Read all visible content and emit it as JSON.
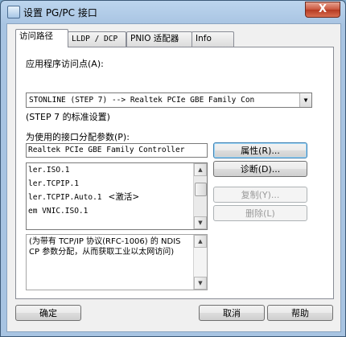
{
  "window": {
    "title": "设置 PG/PC 接口",
    "close_label": "X"
  },
  "tabs": [
    {
      "label": "访问路径"
    },
    {
      "label": "LLDP / DCP"
    },
    {
      "label": "PNIO 适配器"
    },
    {
      "label": "Info"
    }
  ],
  "access_point": {
    "label": "应用程序访问点(A):",
    "value": "STONLINE (STEP 7)        --> Realtek PCIe GBE Family Con",
    "hint": "(STEP 7 的标准设置)"
  },
  "interface": {
    "label": "为使用的接口分配参数(P):",
    "value": "Realtek PCIe GBE Family Controller",
    "items": [
      {
        "text": "ler.ISO.1",
        "tag": ""
      },
      {
        "text": "ler.TCPIP.1",
        "tag": ""
      },
      {
        "text": "ler.TCPIP.Auto.1",
        "tag": "<激活>"
      },
      {
        "text": "em VNIC.ISO.1",
        "tag": ""
      }
    ]
  },
  "buttons": {
    "properties": "属性(R)...",
    "diagnostics": "诊断(D)...",
    "copy": "复制(Y)...",
    "delete": "删除(L)",
    "ok": "确定",
    "cancel": "取消",
    "help": "帮助"
  },
  "description": "(为带有 TCP/IP 协议(RFC-1006) 的 NDIS CP 参数分配，从而获取工业以太网访问)"
}
